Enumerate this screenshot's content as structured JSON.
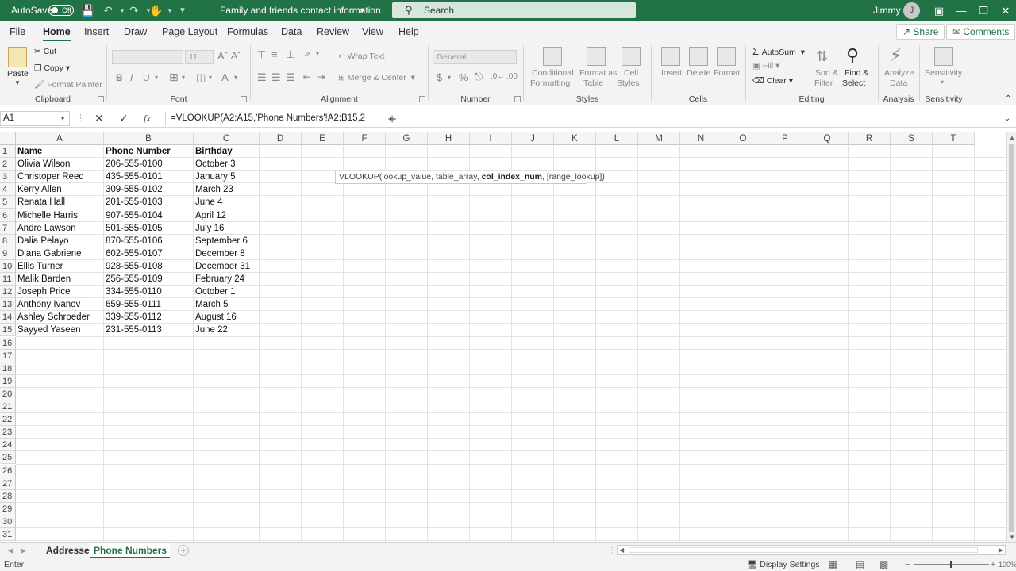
{
  "titlebar": {
    "autosave_label": "AutoSave",
    "autosave_state": "Off",
    "doc_title": "Family and friends contact information",
    "search_placeholder": "Search",
    "user_name": "Jimmy",
    "user_initial": "J"
  },
  "menu": {
    "tabs": [
      "File",
      "Home",
      "Insert",
      "Draw",
      "Page Layout",
      "Formulas",
      "Data",
      "Review",
      "View",
      "Help"
    ],
    "active_tab": "Home",
    "share_label": "Share",
    "comments_label": "Comments"
  },
  "ribbon": {
    "clipboard": {
      "paste": "Paste",
      "cut": "Cut",
      "copy": "Copy",
      "format_painter": "Format Painter",
      "label": "Clipboard"
    },
    "font": {
      "size": "11",
      "label": "Font"
    },
    "alignment": {
      "wrap": "Wrap Text",
      "merge": "Merge & Center",
      "label": "Alignment"
    },
    "number": {
      "format": "General",
      "label": "Number"
    },
    "styles": {
      "conditional": "Conditional",
      "conditional2": "Formatting",
      "format_as": "Format as",
      "format_as2": "Table",
      "cell": "Cell",
      "cell2": "Styles",
      "label": "Styles"
    },
    "cells": {
      "insert": "Insert",
      "delete": "Delete",
      "format": "Format",
      "label": "Cells"
    },
    "editing": {
      "autosum": "AutoSum",
      "fill": "Fill",
      "clear": "Clear",
      "sort": "Sort &",
      "sort2": "Filter",
      "find": "Find &",
      "find2": "Select",
      "label": "Editing"
    },
    "analysis": {
      "analyze": "Analyze",
      "analyze2": "Data",
      "label": "Analysis"
    },
    "sensitivity": {
      "btn": "Sensitivity",
      "label": "Sensitivity"
    }
  },
  "formula_bar": {
    "name_box": "A1",
    "fx": "fx",
    "formula": "=VLOOKUP(A2:A15,'Phone Numbers'!A2:B15,2"
  },
  "tooltip": {
    "pre": "VLOOKUP(lookup_value, table_array, ",
    "bold": "col_index_num",
    "post": ", [range_lookup])"
  },
  "columns": [
    "A",
    "B",
    "C",
    "D",
    "E",
    "F",
    "G",
    "H",
    "I",
    "J",
    "K",
    "L",
    "M",
    "N",
    "O",
    "P",
    "Q",
    "R",
    "S",
    "T"
  ],
  "row_numbers": [
    "1",
    "2",
    "3",
    "4",
    "5",
    "6",
    "7",
    "8",
    "9",
    "10",
    "11",
    "12",
    "13",
    "14",
    "15",
    "16",
    "17",
    "18",
    "19",
    "20",
    "21",
    "22",
    "23",
    "24",
    "25",
    "26",
    "27",
    "28",
    "29",
    "30",
    "31"
  ],
  "table": {
    "headers": [
      "Name",
      "Phone Number",
      "Birthday"
    ],
    "rows": [
      [
        "Olivia Wilson",
        "206-555-0100",
        "October 3"
      ],
      [
        "Christoper Reed",
        "435-555-0101",
        "January 5"
      ],
      [
        "Kerry Allen",
        "309-555-0102",
        "March 23"
      ],
      [
        "Renata Hall",
        "201-555-0103",
        "June 4"
      ],
      [
        "Michelle Harris",
        "907-555-0104",
        "April 12"
      ],
      [
        "Andre Lawson",
        "501-555-0105",
        "July 16"
      ],
      [
        "Dalia Pelayo",
        "870-555-0106",
        "September 6"
      ],
      [
        "Diana Gabriene",
        "602-555-0107",
        "December 8"
      ],
      [
        "Ellis Turner",
        "928-555-0108",
        "December 31"
      ],
      [
        "Malik Barden",
        "256-555-0109",
        "February 24"
      ],
      [
        "Joseph Price",
        "334-555-0110",
        "October 1"
      ],
      [
        "Anthony Ivanov",
        "659-555-0111",
        "March 5"
      ],
      [
        "Ashley Schroeder",
        "339-555-0112",
        "August 16"
      ],
      [
        "Sayyed Yaseen",
        "231-555-0113",
        "June 22"
      ]
    ]
  },
  "sheets": {
    "tab1": "Addresses",
    "tab2": "Phone Numbers",
    "active": "Phone Numbers"
  },
  "status": {
    "mode": "Enter",
    "display_settings": "Display Settings",
    "zoom": "100%"
  }
}
